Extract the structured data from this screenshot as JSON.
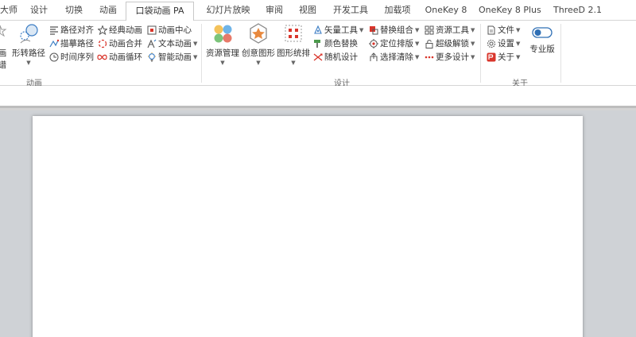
{
  "tabs": [
    {
      "label": "大师"
    },
    {
      "label": "设计"
    },
    {
      "label": "切换"
    },
    {
      "label": "动画"
    },
    {
      "label": "口袋动画 PA",
      "active": true
    },
    {
      "label": "幻灯片放映"
    },
    {
      "label": "审阅"
    },
    {
      "label": "视图"
    },
    {
      "label": "开发工具"
    },
    {
      "label": "加载项"
    },
    {
      "label": "OneKey 8"
    },
    {
      "label": "OneKey 8 Plus"
    },
    {
      "label": "ThreeD 2.1"
    }
  ],
  "ribbon": {
    "groups": {
      "animation": "动画",
      "design": "设计",
      "about": "关于"
    },
    "animation": {
      "partial_left_top": "画",
      "partial_left_bottom": "谱",
      "shape_path": "形转路径",
      "col1": [
        "路径对齐",
        "描摹路径",
        "时间序列"
      ],
      "col2": [
        "经典动画",
        "动画合并",
        "动画循环"
      ],
      "col3": [
        "动画中心",
        "文本动画",
        "智能动画"
      ]
    },
    "design": {
      "big": [
        "资源管理",
        "创意图形",
        "图形统排"
      ],
      "col1": [
        "矢量工具",
        "颜色替换",
        "随机设计"
      ],
      "col2": [
        "替换组合",
        "定位排版",
        "选择清除"
      ],
      "col3": [
        "资源工具",
        "超级解锁",
        "更多设计"
      ]
    },
    "about": {
      "items": [
        "文件",
        "设置",
        "关于"
      ],
      "pro": "专业版"
    }
  },
  "colors": {
    "accent_red": "#d9352b",
    "accent_blue": "#3c7dc4",
    "toggle_blue": "#2f6fb5",
    "tab_border": "#c8c8c8"
  }
}
